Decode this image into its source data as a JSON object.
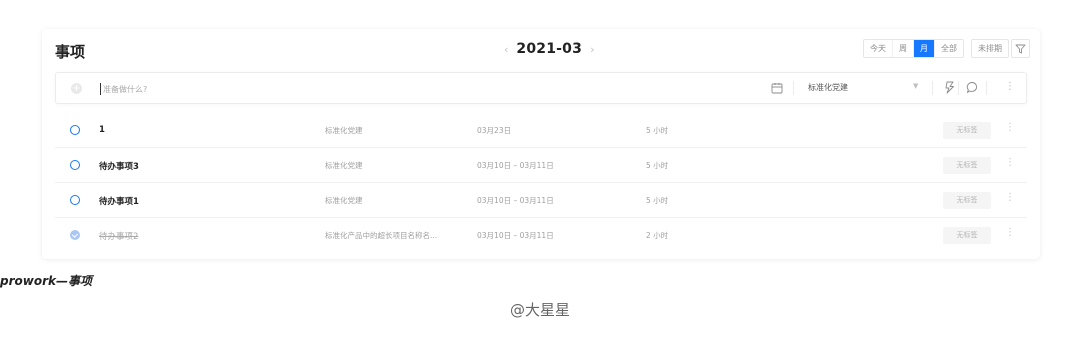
{
  "header": {
    "title": "事项",
    "month": "2021-03",
    "prev_icon": "chevron-left-icon",
    "next_icon": "chevron-right-icon",
    "views": [
      {
        "label": "今天",
        "active": false
      },
      {
        "label": "周",
        "active": false
      },
      {
        "label": "月",
        "active": true
      },
      {
        "label": "全部",
        "active": false
      }
    ],
    "unscheduled_label": "未排期",
    "filter_icon": "filter-icon",
    "accent_color": "#1677ff"
  },
  "input": {
    "placeholder": "准备做什么?",
    "value": "",
    "project": "标准化党建",
    "icons": [
      "add-icon",
      "calendar-icon",
      "chevron-down-icon",
      "tag-icon",
      "chat-icon",
      "more-icon"
    ]
  },
  "tasks": [
    {
      "name": "1",
      "project": "标准化党建",
      "date": "03月23日",
      "duration": "5 小时",
      "tag": "无标签",
      "done": false
    },
    {
      "name": "待办事项3",
      "project": "标准化党建",
      "date": "03月10日 – 03月11日",
      "duration": "5 小时",
      "tag": "无标签",
      "done": false
    },
    {
      "name": "待办事项1",
      "project": "标准化党建",
      "date": "03月10日 – 03月11日",
      "duration": "5 小时",
      "tag": "无标签",
      "done": false
    },
    {
      "name": "待办事项2",
      "project": "标准化产品中的超长项目名称名...",
      "date": "03月10日 – 03月11日",
      "duration": "2 小时",
      "tag": "无标签",
      "done": true
    }
  ],
  "caption": "prowork—事项",
  "watermark": "@大星星"
}
